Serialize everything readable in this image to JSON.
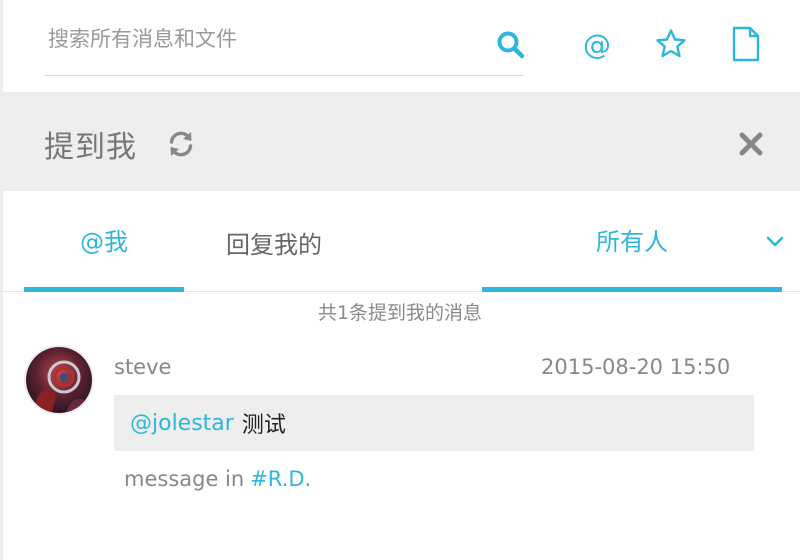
{
  "search": {
    "placeholder": "搜索所有消息和文件"
  },
  "toolbar": {
    "at_symbol": "@",
    "icons": [
      "search-icon",
      "at-icon",
      "star-icon",
      "file-icon"
    ]
  },
  "panel": {
    "title": "提到我"
  },
  "tabs": {
    "mention": "@我",
    "reply": "回复我的",
    "filter_selected": "所有人"
  },
  "summary": "共1条提到我的消息",
  "message": {
    "author": "steve",
    "timestamp": "2015-08-20 15:50",
    "mention": "@jolestar",
    "text": "测试",
    "context_prefix": "message in",
    "channel": "#R.D."
  },
  "colors": {
    "accent": "#2fb6dd",
    "band": "#eeeeee",
    "muted": "#888888"
  }
}
